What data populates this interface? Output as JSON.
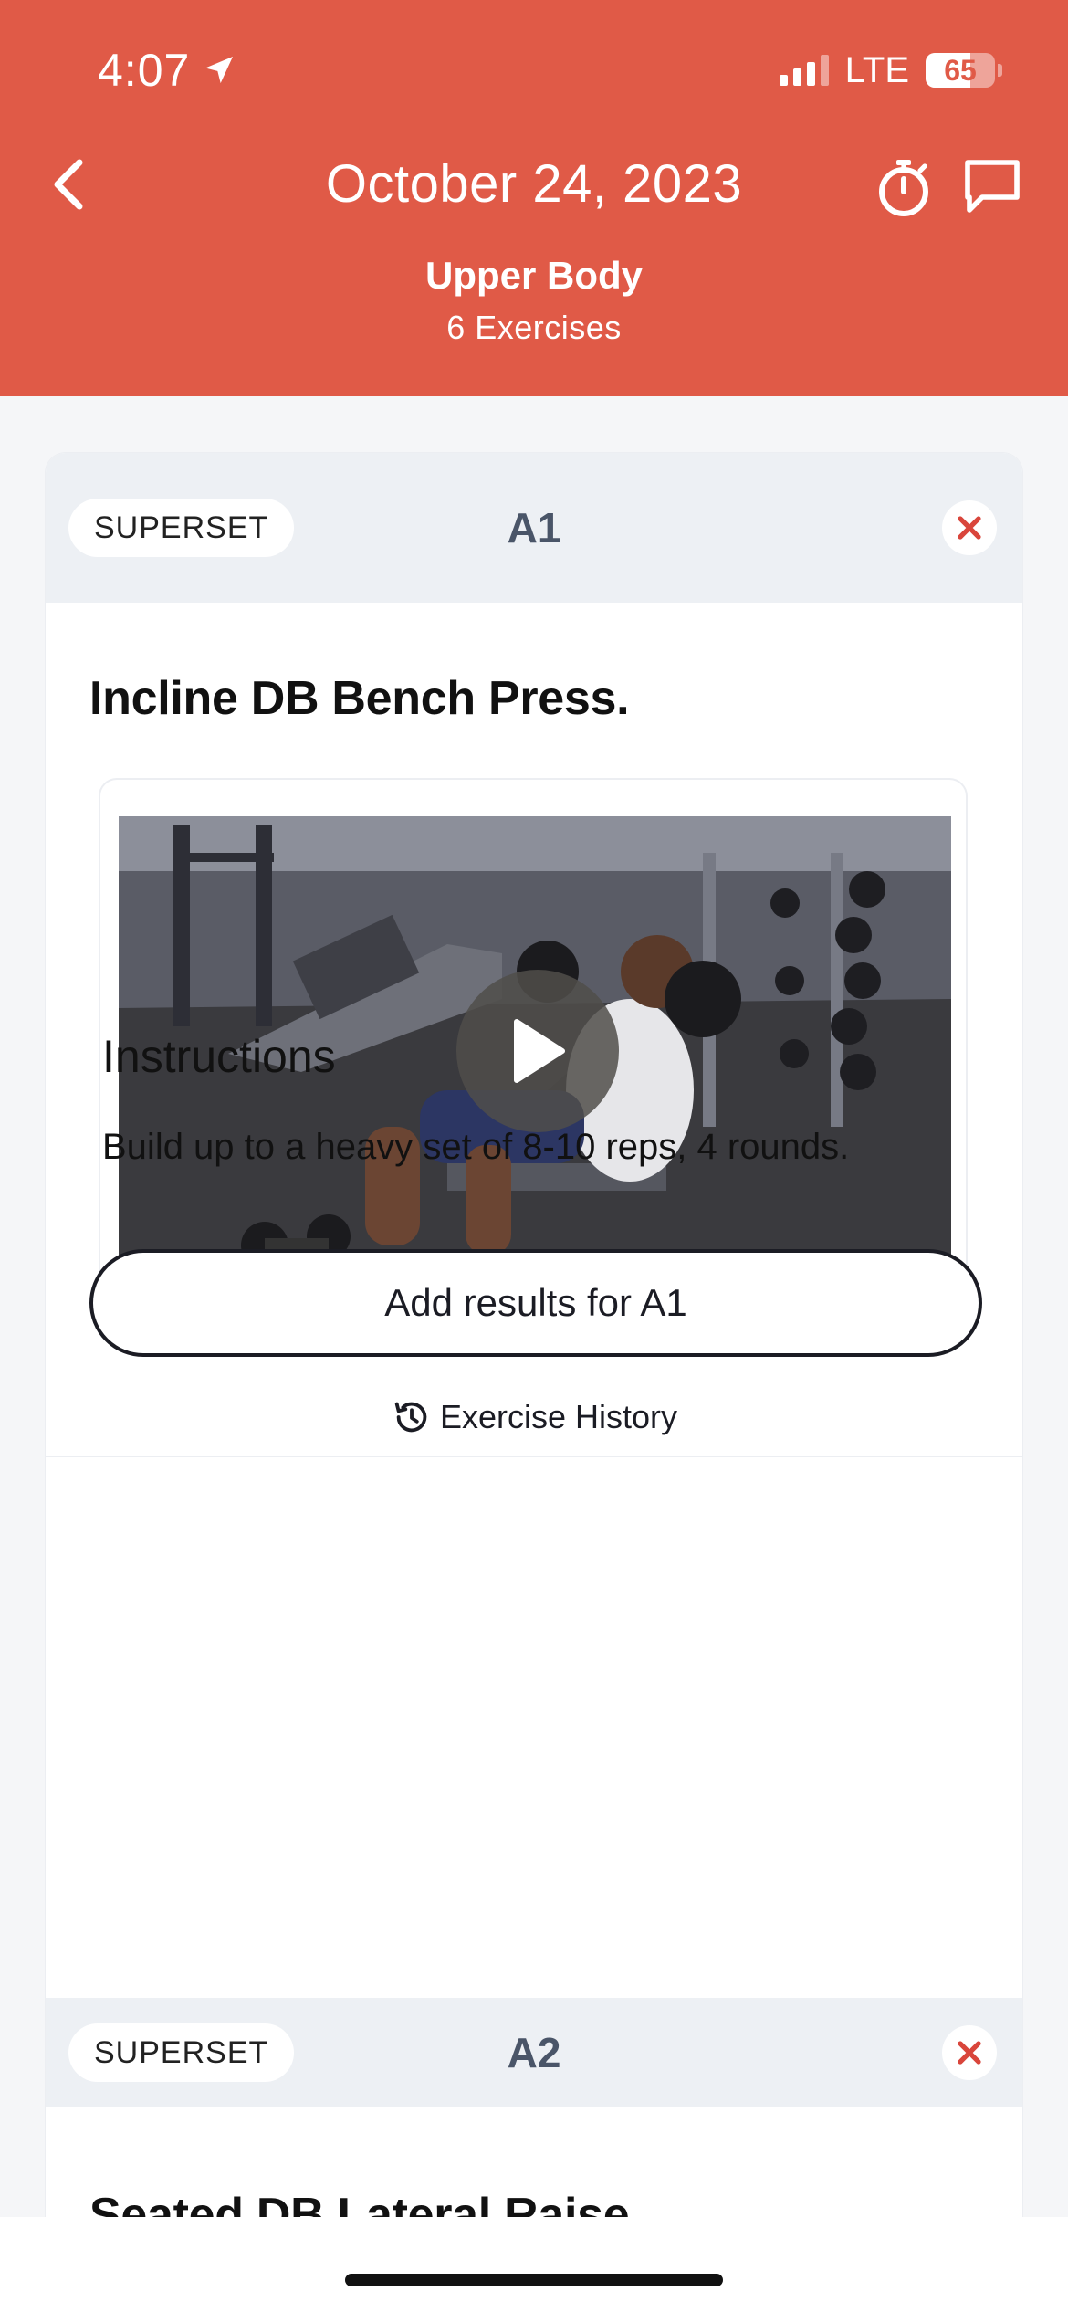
{
  "status_bar": {
    "time": "4:07",
    "network": "LTE",
    "battery": "65"
  },
  "header": {
    "title": "October 24, 2023",
    "subtitle": "Upper Body",
    "count": "6 Exercises",
    "background": "#e05a47"
  },
  "exercises": [
    {
      "tag": "SUPERSET",
      "label": "A1",
      "name": "Incline DB Bench Press.",
      "instructions_heading": "Instructions",
      "instructions": "Build up to a heavy set of 8-10 reps, 4 rounds.",
      "add_results": "Add results for A1",
      "history": "Exercise History"
    },
    {
      "tag": "SUPERSET",
      "label": "A2",
      "name": "Seated DB Lateral Raise"
    }
  ],
  "icons": {
    "location": "location-arrow-icon",
    "back": "chevron-left-icon",
    "timer": "stopwatch-icon",
    "chat": "chat-bubble-icon",
    "close": "close-icon",
    "play": "play-icon",
    "history": "history-icon"
  },
  "colors": {
    "accent": "#e05a47",
    "close_x": "#d9453b",
    "label": "#4a5568"
  }
}
